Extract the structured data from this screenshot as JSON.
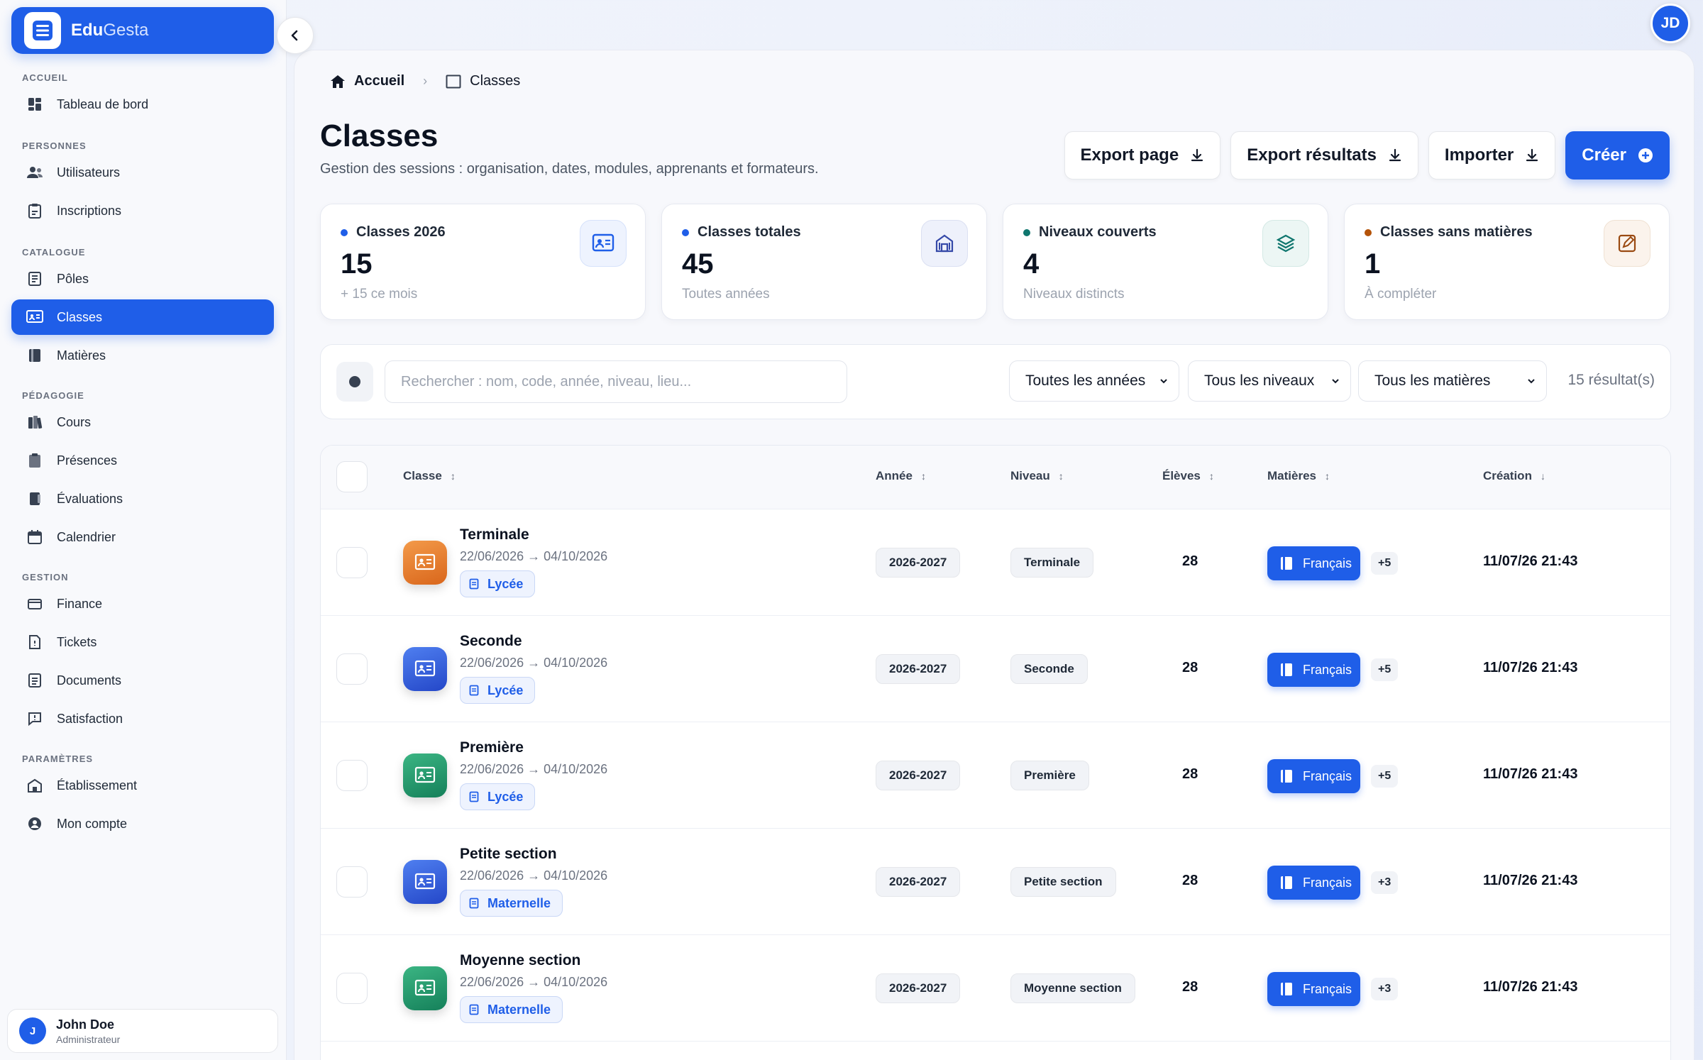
{
  "brand": {
    "name_part1": "Edu",
    "name_part2": "Gesta"
  },
  "sidebar": {
    "sections": [
      {
        "label": "ACCUEIL"
      },
      {
        "label": "PERSONNES"
      },
      {
        "label": "CATALOGUE"
      },
      {
        "label": "PÉDAGOGIE"
      },
      {
        "label": "GESTION"
      },
      {
        "label": "PARAMÈTRES"
      }
    ],
    "items": [
      {
        "label": "Tableau de bord",
        "icon": "dashboard-icon"
      },
      {
        "label": "Utilisateurs",
        "icon": "users-icon"
      },
      {
        "label": "Inscriptions",
        "icon": "clipboard-icon"
      },
      {
        "label": "Pôles",
        "icon": "document-icon"
      },
      {
        "label": "Classes",
        "icon": "classroom-icon",
        "active": true
      },
      {
        "label": "Matières",
        "icon": "book-icon"
      },
      {
        "label": "Cours",
        "icon": "books-icon"
      },
      {
        "label": "Présences",
        "icon": "clipboard-check-icon"
      },
      {
        "label": "Évaluations",
        "icon": "notebook-icon"
      },
      {
        "label": "Calendrier",
        "icon": "calendar-icon"
      },
      {
        "label": "Finance",
        "icon": "wallet-icon"
      },
      {
        "label": "Tickets",
        "icon": "ticket-icon"
      },
      {
        "label": "Documents",
        "icon": "file-icon"
      },
      {
        "label": "Satisfaction",
        "icon": "chat-icon"
      },
      {
        "label": "Établissement",
        "icon": "building-icon"
      },
      {
        "label": "Mon compte",
        "icon": "account-icon"
      }
    ],
    "user": {
      "initial": "J",
      "name": "John Doe",
      "role": "Administrateur"
    }
  },
  "top_avatar": "JD",
  "breadcrumb": {
    "home": "Accueil",
    "current": "Classes"
  },
  "header": {
    "title": "Classes",
    "subtitle": "Gestion des sessions : organisation, dates, modules, apprenants et formateurs.",
    "buttons": {
      "export_page": "Export page",
      "export_results": "Export résultats",
      "import": "Importer",
      "create": "Créer"
    }
  },
  "stats": [
    {
      "label": "Classes 2026",
      "value": "15",
      "note": "+ 15 ce mois",
      "dot_color": "#1f5ee8",
      "icon": "classroom-icon"
    },
    {
      "label": "Classes totales",
      "value": "45",
      "note": "Toutes années",
      "dot_color": "#1f5ee8",
      "icon": "school-icon"
    },
    {
      "label": "Niveaux couverts",
      "value": "4",
      "note": "Niveaux distincts",
      "dot_color": "#0f766e",
      "icon": "layers-icon"
    },
    {
      "label": "Classes sans matières",
      "value": "1",
      "note": "À compléter",
      "dot_color": "#b45309",
      "icon": "edit-icon"
    }
  ],
  "filters": {
    "search_placeholder": "Rechercher : nom, code, année, niveau, lieu...",
    "year": "Toutes les années",
    "level": "Tous les niveaux",
    "subject": "Tous les matières",
    "results": "15 résultat(s)"
  },
  "table": {
    "columns": {
      "classe": "Classe",
      "annee": "Année",
      "niveau": "Niveau",
      "eleves": "Élèves",
      "matieres": "Matières",
      "creation": "Création"
    },
    "rows": [
      {
        "name": "Terminale",
        "dates": "22/06/2026 → 04/10/2026",
        "tag": "Lycée",
        "year": "2026-2027",
        "level": "Terminale",
        "students": "28",
        "subject": "Français",
        "more": "+5",
        "created": "11/07/26 21:43",
        "color": "orange"
      },
      {
        "name": "Seconde",
        "dates": "22/06/2026 → 04/10/2026",
        "tag": "Lycée",
        "year": "2026-2027",
        "level": "Seconde",
        "students": "28",
        "subject": "Français",
        "more": "+5",
        "created": "11/07/26 21:43",
        "color": "blue"
      },
      {
        "name": "Première",
        "dates": "22/06/2026 → 04/10/2026",
        "tag": "Lycée",
        "year": "2026-2027",
        "level": "Première",
        "students": "28",
        "subject": "Français",
        "more": "+5",
        "created": "11/07/26 21:43",
        "color": "green"
      },
      {
        "name": "Petite section",
        "dates": "22/06/2026 → 04/10/2026",
        "tag": "Maternelle",
        "year": "2026-2027",
        "level": "Petite section",
        "students": "28",
        "subject": "Français",
        "more": "+3",
        "created": "11/07/26 21:43",
        "color": "blue"
      },
      {
        "name": "Moyenne section",
        "dates": "22/06/2026 → 04/10/2026",
        "tag": "Maternelle",
        "year": "2026-2027",
        "level": "Moyenne section",
        "students": "28",
        "subject": "Français",
        "more": "+3",
        "created": "11/07/26 21:43",
        "color": "green"
      }
    ]
  },
  "colors": {
    "accent": "#1f5ee8",
    "orange": "#e8792b",
    "blue": "#2f5fe0",
    "green": "#1f9a6b"
  }
}
